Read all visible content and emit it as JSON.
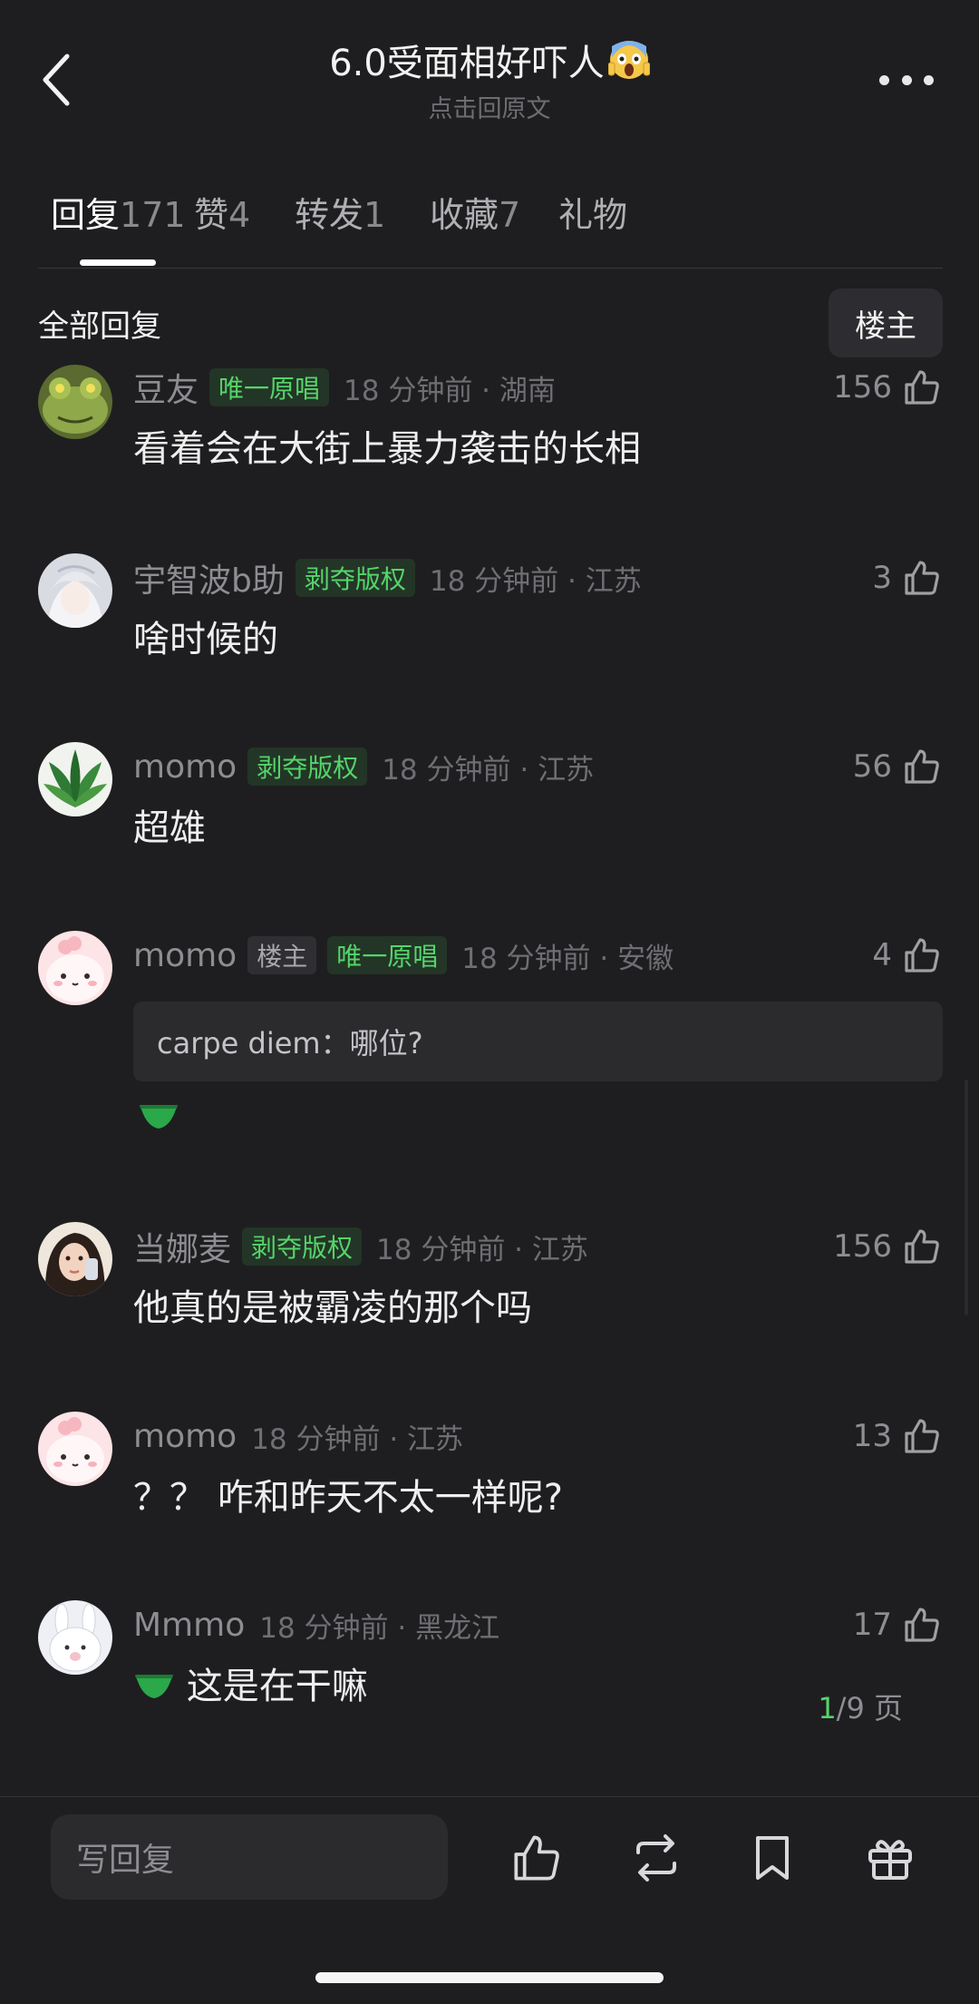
{
  "header": {
    "title": "6.0受面相好吓人",
    "title_emoji": "screaming-face-emoji",
    "subtitle": "点击回原文"
  },
  "tabs": [
    {
      "label": "回复",
      "count": "171",
      "active": true
    },
    {
      "label": "赞",
      "count": "4"
    },
    {
      "label": "转发",
      "count": "1"
    },
    {
      "label": "收藏",
      "count": "7"
    },
    {
      "label": "礼物",
      "count": ""
    }
  ],
  "filter": {
    "all_label": "全部回复",
    "op_label": "楼主"
  },
  "comments": [
    {
      "name": "豆友",
      "badges": [
        "唯一原唱"
      ],
      "time": "18 分钟前 · 湖南",
      "likes": "156",
      "text": "看着会在大街上暴力袭击的长相",
      "avatar": "frog-avatar"
    },
    {
      "name": "宇智波b助",
      "badges": [
        "剥夺版权"
      ],
      "time": "18 分钟前 · 江苏",
      "likes": "3",
      "text": "啥时候的",
      "avatar": "anime-avatar"
    },
    {
      "name": "momo",
      "badges": [
        "剥夺版权"
      ],
      "time": "18 分钟前 · 江苏",
      "likes": "56",
      "text": "超雄",
      "avatar": "leaves-avatar"
    },
    {
      "name": "momo",
      "badges": [
        "楼主",
        "唯一原唱"
      ],
      "time": "18 分钟前 · 安徽",
      "likes": "4",
      "quote": "carpe diem：哪位?",
      "text": "",
      "avatar": "pink-blob-avatar",
      "sticker": "green-underwear-sticker"
    },
    {
      "name": "当娜麦",
      "badges": [
        "剥夺版权"
      ],
      "time": "18 分钟前 · 江苏",
      "likes": "156",
      "text": "他真的是被霸凌的那个吗",
      "avatar": "selfie-avatar"
    },
    {
      "name": "momo",
      "badges": [],
      "time": "18 分钟前 · 江苏",
      "likes": "13",
      "text": "？？ 咋和昨天不太一样呢?",
      "avatar": "pink-blob-avatar"
    },
    {
      "name": "Mmmo",
      "badges": [],
      "time": "18 分钟前 · 黑龙江",
      "likes": "17",
      "text": "这是在干嘛",
      "avatar": "bunny-avatar",
      "sticker": "green-underwear-sticker"
    }
  ],
  "pager": {
    "current": "1",
    "total": "/9 页"
  },
  "bottom_bar": {
    "reply_placeholder": "写回复",
    "buttons": [
      "like-icon",
      "repost-icon",
      "bookmark-icon",
      "gift-icon"
    ]
  },
  "colors": {
    "background": "#1e1e20",
    "badge_green": "#55d46a",
    "muted": "#8d8d92"
  }
}
